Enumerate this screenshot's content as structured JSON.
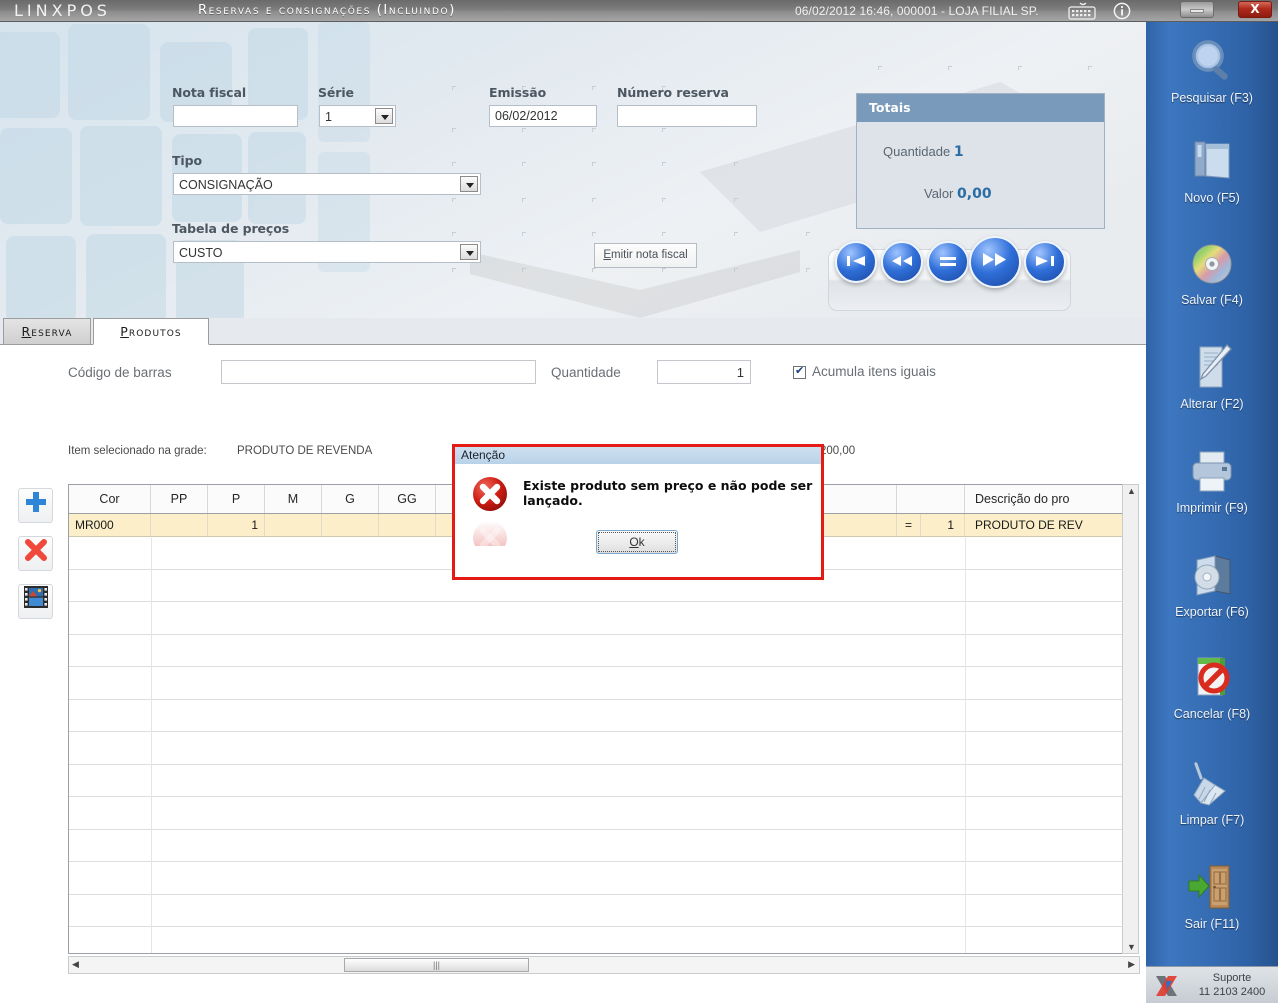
{
  "titlebar": {
    "logo": "LINXPOS",
    "title": "Reservas e consignações (Incluindo)",
    "status": "06/02/2012 16:46, 000001 - LOJA FILIAL SP.",
    "keyboard_icon": "keyboard-icon",
    "info_icon": "info-icon",
    "minimize_label": "",
    "close_label": "X"
  },
  "form": {
    "nota_fiscal": {
      "label": "Nota fiscal",
      "value": "",
      "placeholder": ""
    },
    "serie": {
      "label": "Série",
      "value": "1"
    },
    "emissao": {
      "label": "Emissão",
      "value": "06/02/2012"
    },
    "numero_reserva": {
      "label": "Número reserva",
      "value": "",
      "placeholder": ""
    },
    "tipo": {
      "label": "Tipo",
      "value": "CONSIGNAÇÃO"
    },
    "tabela_precos": {
      "label": "Tabela de preços",
      "value": "CUSTO"
    },
    "emitir_nf": {
      "label_prefix": "E",
      "label_rest": "mitir nota fiscal"
    }
  },
  "totais": {
    "header": "Totais",
    "quantidade_label": "Quantidade",
    "quantidade_value": "1",
    "valor_label": "Valor",
    "valor_value": "0,00"
  },
  "navigation": {
    "first": "first-record-icon",
    "prev": "previous-record-icon",
    "stop": "equals-icon",
    "next": "next-record-icon",
    "last": "last-record-icon"
  },
  "tabs": [
    {
      "label": "Reserva",
      "underline": "R",
      "rest": "eserva",
      "active": false
    },
    {
      "label": "Produtos",
      "underline": "P",
      "rest": "rodutos",
      "active": true
    }
  ],
  "produtos": {
    "codigo_barras_label": "Código de barras",
    "codigo_barras_value": "",
    "quantidade_label": "Quantidade",
    "quantidade_value": "1",
    "acumula_label": "Acumula itens iguais",
    "acumula_checked": true,
    "item_selecionado_label": "Item selecionado na grade:",
    "item_selecionado_nome": "PRODUTO DE REVENDA",
    "item_selecionado_valor": "200,00"
  },
  "left_tools": [
    {
      "name": "add-item-button",
      "glyph": "+"
    },
    {
      "name": "remove-item-button",
      "glyph": "✕"
    },
    {
      "name": "image-item-button",
      "glyph": "▦"
    }
  ],
  "grid": {
    "columns": [
      "Cor",
      "PP",
      "P",
      "M",
      "G",
      "GG",
      "",
      "",
      "",
      "",
      "",
      "",
      "Descrição do pro"
    ],
    "row": {
      "cor": "MR000",
      "pp": "",
      "p": "1",
      "m": "",
      "g": "",
      "gg": "",
      "total_sign": "=",
      "total": "1",
      "descricao": "PRODUTO DE REV"
    },
    "hscroll_thumb_glyph": "|||"
  },
  "sidebar": {
    "items": [
      {
        "label": "Pesquisar (F3)",
        "icon": "magnifier-icon"
      },
      {
        "label": "Novo (F5)",
        "icon": "new-document-icon"
      },
      {
        "label": "Salvar (F4)",
        "icon": "save-disc-icon"
      },
      {
        "label": "Alterar (F2)",
        "icon": "edit-pencil-icon"
      },
      {
        "label": "Imprimir (F9)",
        "icon": "printer-icon"
      },
      {
        "label": "Exportar (F6)",
        "icon": "export-disc-icon"
      },
      {
        "label": "Cancelar (F8)",
        "icon": "cancel-forbidden-icon"
      },
      {
        "label": "Limpar (F7)",
        "icon": "broom-icon"
      },
      {
        "label": "Sair (F11)",
        "icon": "exit-door-icon"
      }
    ],
    "support": {
      "icon": "linx-logo-icon",
      "line1": "Suporte",
      "line2": "11 2103 2400"
    }
  },
  "dialog": {
    "title": "Atenção",
    "icon": "error-circle-icon",
    "message": "Existe produto sem preço e não pode ser lançado.",
    "ok_underline": "O",
    "ok_rest": "k"
  },
  "colors": {
    "accent_blue": "#2f63a8",
    "error_red": "#e31b14",
    "totais_header": "#7a9abb",
    "row_highlight": "#fbeec9"
  }
}
